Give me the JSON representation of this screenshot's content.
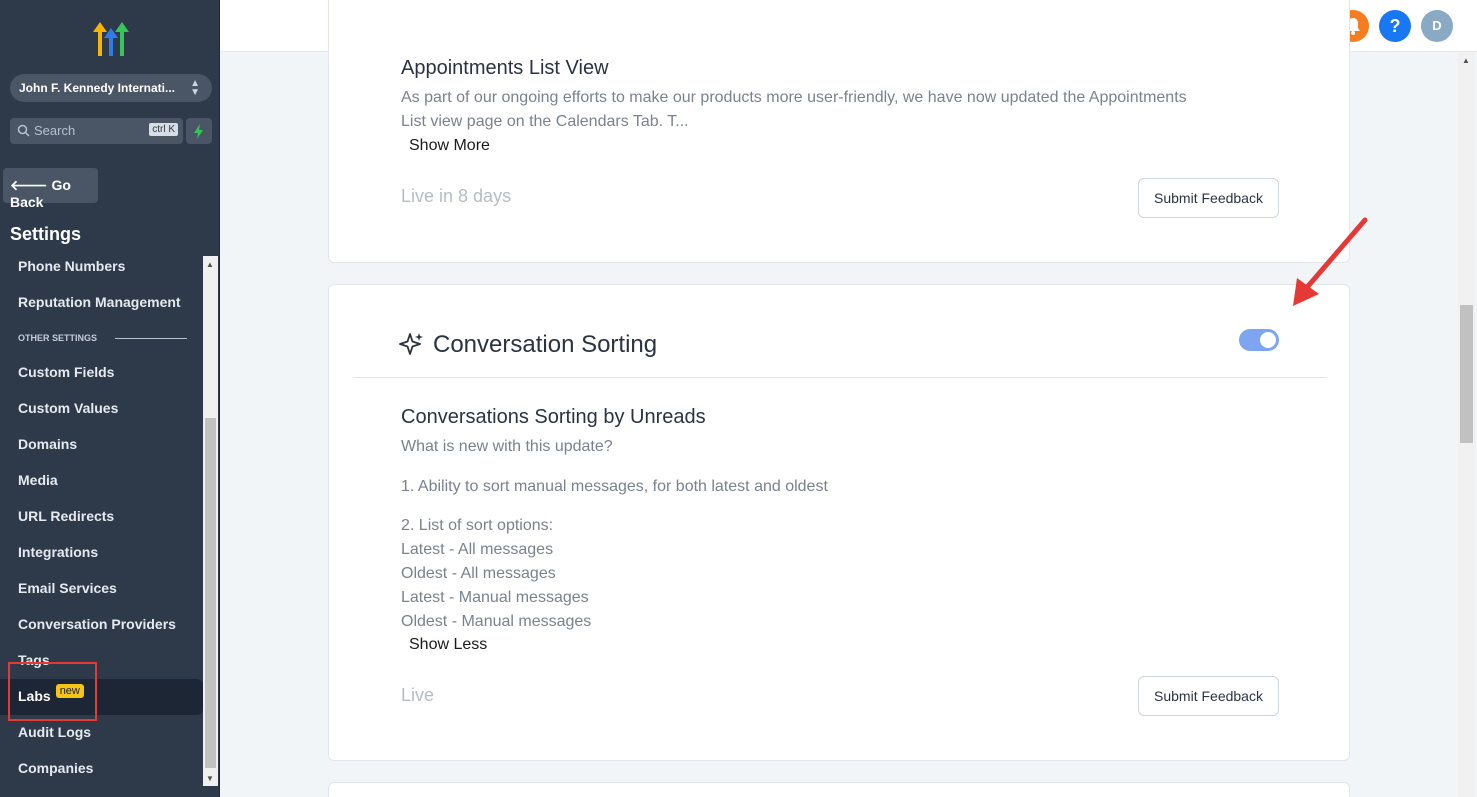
{
  "sidebar": {
    "location": "John F. Kennedy Internati...",
    "search_placeholder": "Search",
    "search_shortcut": "ctrl K",
    "go_back": "Go Back",
    "settings_title": "Settings",
    "items_top": [
      "Phone Numbers",
      "Reputation Management"
    ],
    "section_label": "OTHER SETTINGS",
    "items": [
      "Custom Fields",
      "Custom Values",
      "Domains",
      "Media",
      "URL Redirects",
      "Integrations",
      "Email Services",
      "Conversation Providers",
      "Tags",
      "Labs",
      "Audit Logs",
      "Companies"
    ],
    "labs_badge": "new",
    "active_item": "Labs"
  },
  "header": {
    "avatar_initial": "D",
    "help_glyph": "?"
  },
  "cards": [
    {
      "title": "Appointments List View",
      "description_line1": "As part of our ongoing efforts to make our products more user-friendly, we have now updated the Appointments",
      "description_line2": "List view page on the Calendars Tab. T...",
      "toggle_text": "Show More",
      "status": "Live in 8 days",
      "feedback": "Submit Feedback"
    },
    {
      "feature_name": "Conversation Sorting",
      "enabled": true,
      "title": "Conversations Sorting by Unreads",
      "intro": "What is new with this update?",
      "point1": "1. Ability to sort manual messages, for both latest and oldest",
      "point2": "2. List of sort options:",
      "options": [
        "Latest - All messages",
        "Oldest - All messages",
        "Latest - Manual messages",
        "Oldest - Manual messages"
      ],
      "toggle_text": "Show Less",
      "status": "Live",
      "feedback": "Submit Feedback"
    }
  ],
  "colors": {
    "sidebar_bg": "#2e3a4a",
    "accent_toggle": "#7ea5ef",
    "annotation_red": "#e53935",
    "badge_yellow": "#f5c518"
  }
}
